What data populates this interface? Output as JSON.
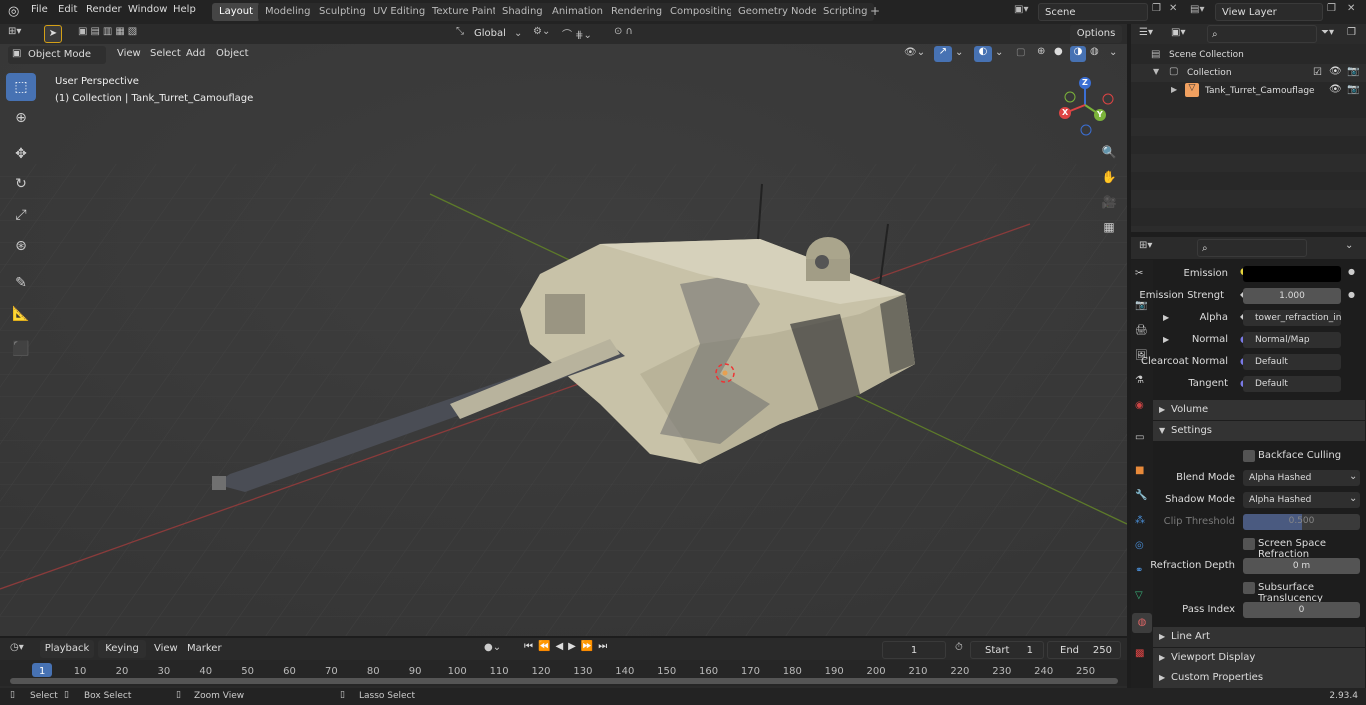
{
  "menu": {
    "file": "File",
    "edit": "Edit",
    "render": "Render",
    "window": "Window",
    "help": "Help"
  },
  "workspaces": [
    "Layout",
    "Modeling",
    "Sculpting",
    "UV Editing",
    "Texture Paint",
    "Shading",
    "Animation",
    "Rendering",
    "Compositing",
    "Geometry Nodes",
    "Scripting"
  ],
  "scene": {
    "label": "Scene",
    "view_layer": "View Layer"
  },
  "toolbar": {
    "mode": "Object Mode",
    "view": "View",
    "select": "Select",
    "add": "Add",
    "object": "Object",
    "orientation": "Global",
    "options": "Options"
  },
  "viewport": {
    "perspective": "User Perspective",
    "collection_info": "(1) Collection | Tank_Turret_Camouflage"
  },
  "gizmo": {
    "x": "X",
    "y": "Y",
    "z": "Z"
  },
  "outliner": {
    "scene_collection": "Scene Collection",
    "collection": "Collection",
    "object": "Tank_Turret_Camouflage"
  },
  "properties": {
    "emission": "Emission",
    "emission_strength": "Emission Strengt",
    "emission_strength_value": "1.000",
    "alpha": "Alpha",
    "alpha_value": "tower_refraction_inv...",
    "normal": "Normal",
    "normal_value": "Normal/Map",
    "clearcoat_normal": "Clearcoat Normal",
    "clearcoat_value": "Default",
    "tangent": "Tangent",
    "tangent_value": "Default",
    "volume": "Volume",
    "settings": "Settings",
    "backface": "Backface Culling",
    "blend_mode": "Blend Mode",
    "blend_mode_value": "Alpha Hashed",
    "shadow_mode": "Shadow Mode",
    "shadow_mode_value": "Alpha Hashed",
    "clip_threshold": "Clip Threshold",
    "clip_threshold_value": "0.500",
    "ssr": "Screen Space Refraction",
    "refraction_depth": "Refraction Depth",
    "refraction_depth_value": "0 m",
    "subsurface": "Subsurface Translucency",
    "pass_index": "Pass Index",
    "pass_index_value": "0",
    "line_art": "Line Art",
    "viewport_display": "Viewport Display",
    "custom_properties": "Custom Properties"
  },
  "timeline": {
    "playback": "Playback",
    "keying": "Keying",
    "view": "View",
    "marker": "Marker",
    "current_frame": "1",
    "start_label": "Start",
    "start": "1",
    "end_label": "End",
    "end": "250",
    "ticks": [
      "1",
      "10",
      "20",
      "30",
      "40",
      "50",
      "60",
      "70",
      "80",
      "90",
      "100",
      "110",
      "120",
      "130",
      "140",
      "150",
      "160",
      "170",
      "180",
      "190",
      "200",
      "210",
      "220",
      "230",
      "240",
      "250"
    ]
  },
  "status": {
    "select": "Select",
    "box_select": "Box Select",
    "zoom_view": "Zoom View",
    "lasso_select": "Lasso Select",
    "version": "2.93.4"
  }
}
